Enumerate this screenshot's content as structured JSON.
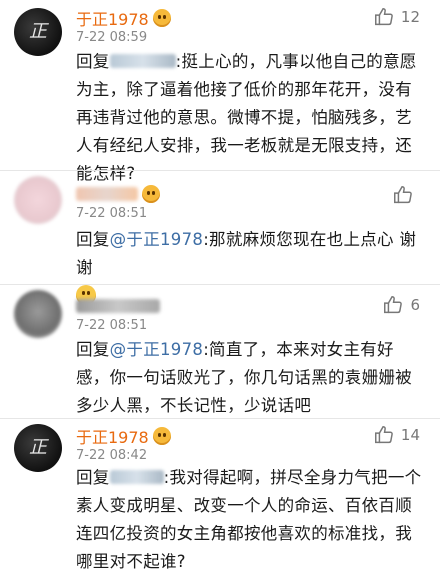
{
  "comments": [
    {
      "name": "于正1978",
      "time": "7-22 08:59",
      "likes": "12",
      "reply_prefix": "回复",
      "reply_to_blurred": true,
      "text": ":挺上心的，凡事以他自己的意愿为主，除了逼着他接了低价的那年花开，没有再违背过他的意思。微博不提，怕脑残多，艺人有经纪人安排，我一老板就是无限支持，还能怎样?"
    },
    {
      "name": "",
      "time": "7-22 08:51",
      "likes": "",
      "reply_prefix": "回复",
      "reply_to": "@于正1978",
      "text": ":那就麻烦您现在也上点心 谢谢",
      "emoji": "smile-emoji"
    },
    {
      "name": "",
      "time": "7-22 08:51",
      "likes": "6",
      "reply_prefix": "回复",
      "reply_to": "@于正1978",
      "text": ":简直了，本来对女主有好感，你一句话败光了，你几句话黑的袁姗姗被多少人黑，不长记性，少说话吧"
    },
    {
      "name": "于正1978",
      "time": "7-22 08:42",
      "likes": "14",
      "reply_prefix": "回复",
      "reply_to_blurred": true,
      "text": ":我对得起啊，拼尽全身力气把一个素人变成明星、改变一个人的命运、百依百顺连四亿投资的女主角都按他喜欢的标准找，我哪里对不起谁?"
    }
  ],
  "colors": {
    "username": "#e86a10",
    "mention": "#3e6ea5",
    "meta": "#888888"
  },
  "icons": {
    "like": "thumbs-up-icon",
    "verified": "v-badge-icon",
    "vip": "smiley-badge-icon"
  }
}
